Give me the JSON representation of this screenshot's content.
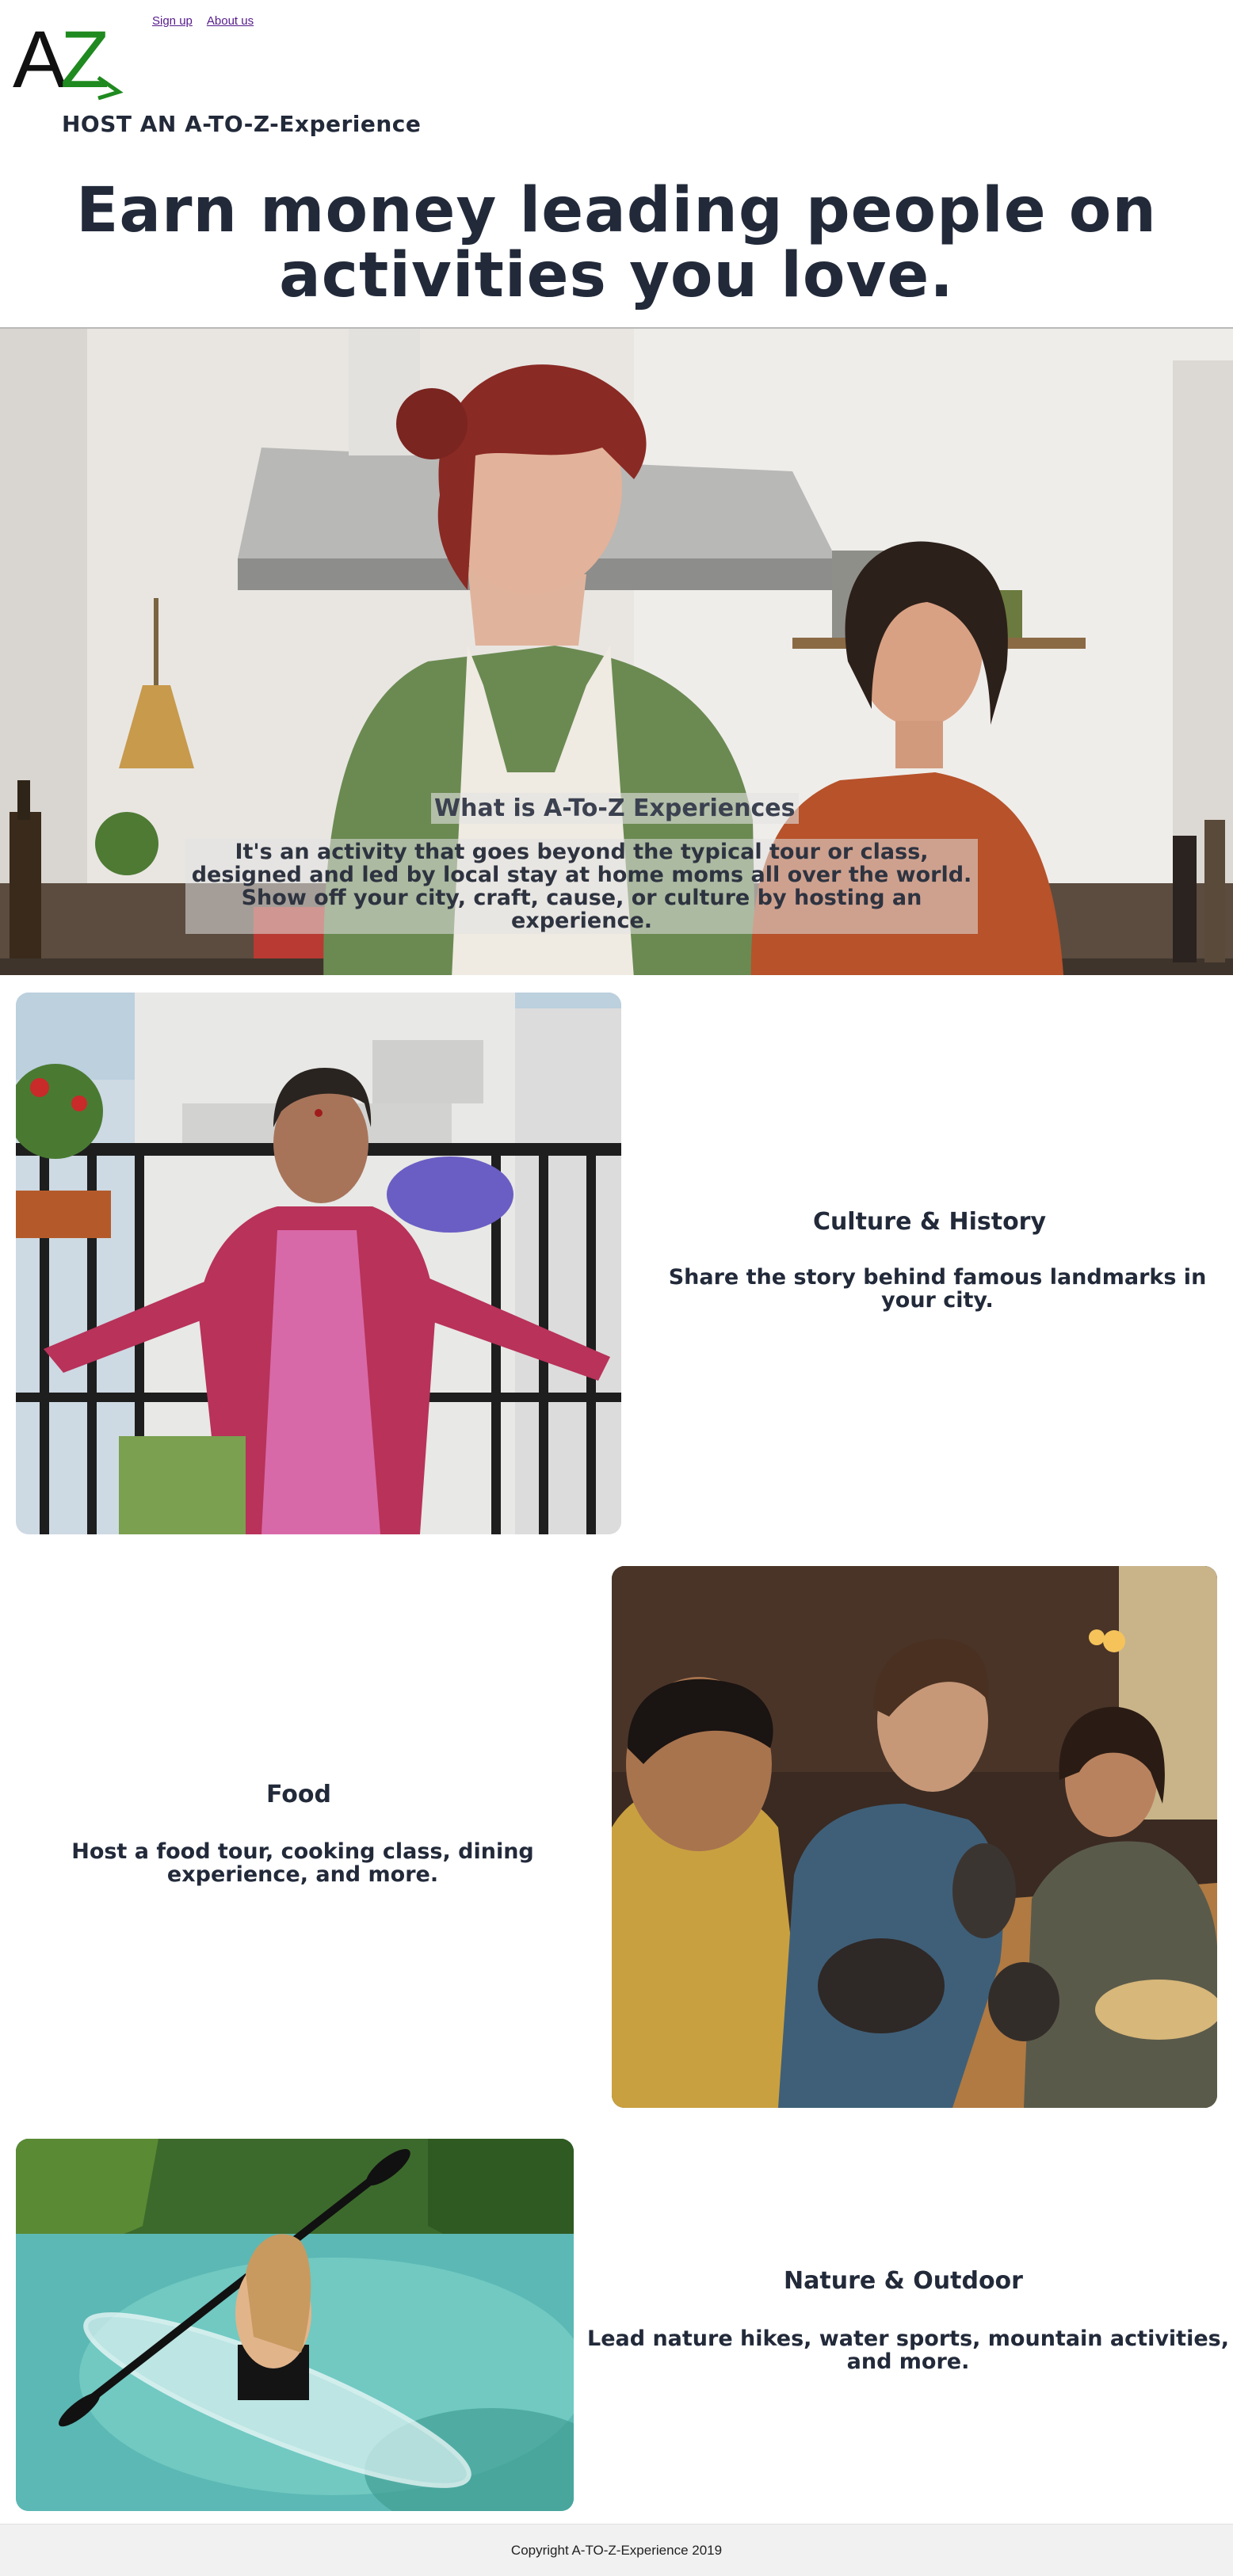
{
  "brand": {
    "logo_text_a": "A",
    "logo_text_z": "Z",
    "accent": "#1f8a1f"
  },
  "nav": {
    "signup": "Sign up",
    "about": "About us"
  },
  "host_title": "HOST AN A-TO-Z-Experience",
  "headline": {
    "line1": "Earn money leading people on",
    "line2": "activities you love."
  },
  "hero": {
    "image": "kitchen-two-women-laughing",
    "heading": "What is A-To-Z Experiences",
    "text": "It's an activity that goes beyond the typical tour or class, designed and led by local stay at home moms all over the world. Show off your city, craft, cause, or culture by hosting an experience."
  },
  "sections": [
    {
      "image": "woman-on-balcony",
      "title": "Culture & History",
      "text": "Share the story behind famous landmarks in your city."
    },
    {
      "image": "friends-eating-tacos",
      "title": "Food",
      "text": "Host a food tour, cooking class, dining experience, and more."
    },
    {
      "image": "clear-kayak-river",
      "title": "Nature & Outdoor",
      "text": "Lead nature hikes, water sports, mountain activities, and more."
    }
  ],
  "footer": {
    "copyright": "Copyright A-TO-Z-Experience 2019"
  }
}
